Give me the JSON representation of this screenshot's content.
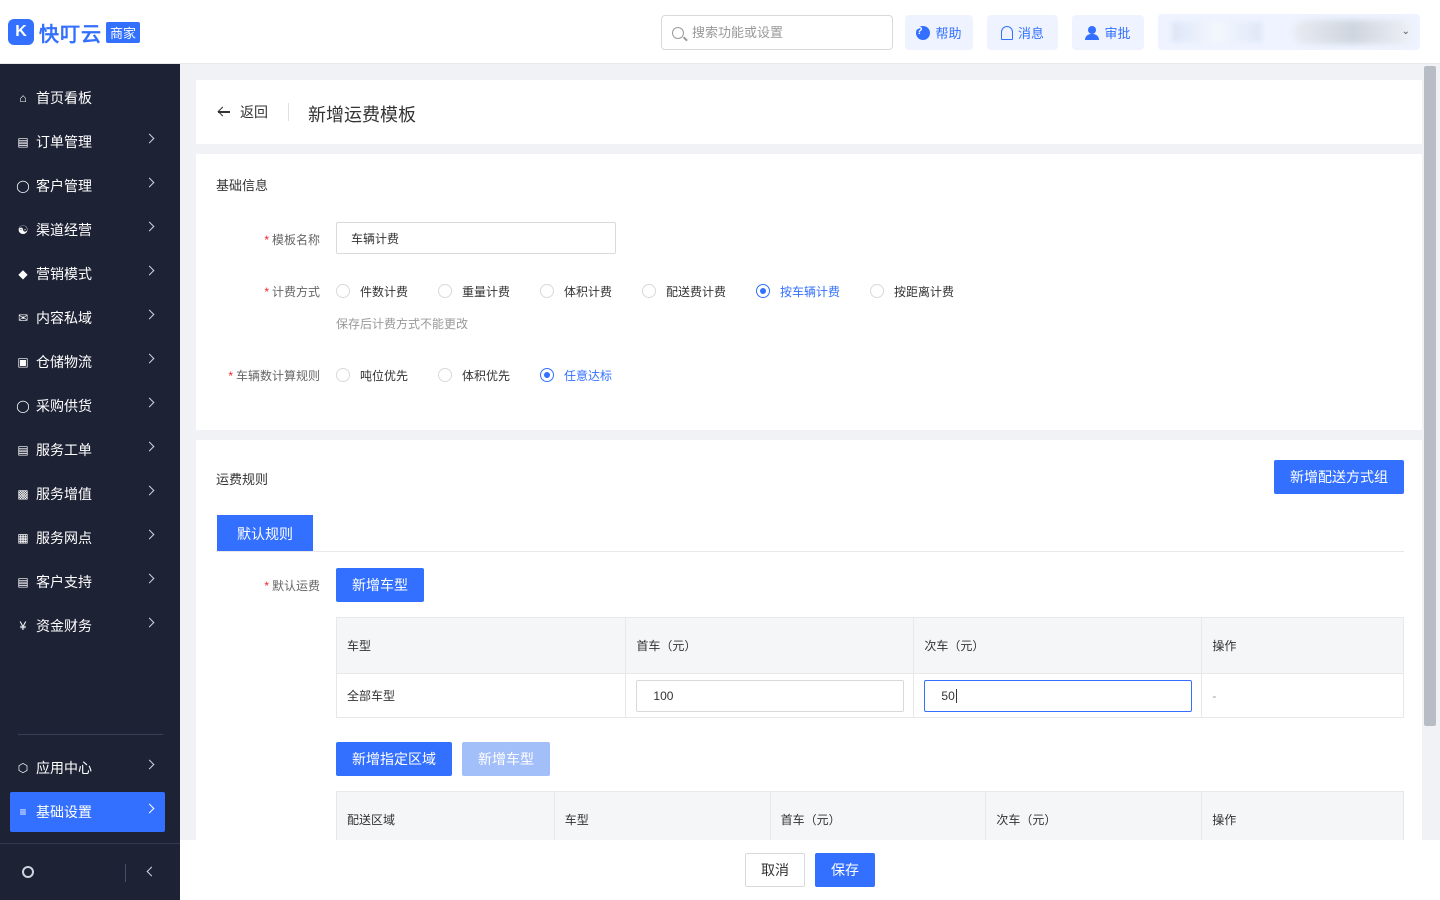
{
  "header": {
    "logo_text": "快叮云",
    "logo_badge": "商家",
    "search_placeholder": "搜索功能或设置",
    "help_label": "帮助",
    "messages_label": "消息",
    "approval_label": "审批"
  },
  "sidebar": {
    "items": [
      {
        "label": "首页看板",
        "icon": "home-icon"
      },
      {
        "label": "订单管理",
        "icon": "order-icon"
      },
      {
        "label": "客户管理",
        "icon": "user-icon"
      },
      {
        "label": "渠道经营",
        "icon": "channel-icon"
      },
      {
        "label": "营销模式",
        "icon": "tag-icon"
      },
      {
        "label": "内容私域",
        "icon": "mail-icon"
      },
      {
        "label": "仓储物流",
        "icon": "warehouse-icon"
      },
      {
        "label": "采购供货",
        "icon": "purchase-icon"
      },
      {
        "label": "服务工单",
        "icon": "ticket-icon"
      },
      {
        "label": "服务增值",
        "icon": "gift-icon"
      },
      {
        "label": "服务网点",
        "icon": "store-icon"
      },
      {
        "label": "客户支持",
        "icon": "support-icon"
      },
      {
        "label": "资金财务",
        "icon": "yen-icon"
      }
    ],
    "bottom_items": [
      {
        "label": "应用中心",
        "icon": "cube-icon"
      },
      {
        "label": "基础设置",
        "icon": "settings-list-icon",
        "active": true
      }
    ]
  },
  "page": {
    "back_label": "返回",
    "title": "新增运费模板"
  },
  "basic_info": {
    "section_title": "基础信息",
    "template_name_label": "模板名称",
    "template_name_value": "车辆计费",
    "billing_method_label": "计费方式",
    "billing_options": [
      "件数计费",
      "重量计费",
      "体积计费",
      "配送费计费",
      "按车辆计费",
      "按距离计费"
    ],
    "billing_selected": "按车辆计费",
    "billing_hint": "保存后计费方式不能更改",
    "vehicle_rule_label": "车辆数计算规则",
    "vehicle_rule_options": [
      "吨位优先",
      "体积优先",
      "任意达标"
    ],
    "vehicle_rule_selected": "任意达标"
  },
  "freight_rules": {
    "section_title": "运费规则",
    "add_group_button": "新增配送方式组",
    "tab_default": "默认规则",
    "default_fee_label": "默认运费",
    "add_vehicle_button": "新增车型",
    "default_table": {
      "headers": [
        "车型",
        "首车（元）",
        "次车（元）",
        "操作"
      ],
      "rows": [
        {
          "vehicle": "全部车型",
          "first": "100",
          "next": "50",
          "action": "-"
        }
      ]
    },
    "add_region_button": "新增指定区域",
    "add_vehicle_button_disabled": "新增车型",
    "region_table": {
      "headers": [
        "配送区域",
        "车型",
        "首车（元）",
        "次车（元）",
        "操作"
      ]
    }
  },
  "footer": {
    "cancel_label": "取消",
    "save_label": "保存"
  },
  "colors": {
    "primary": "#3370ff",
    "sidebar_bg": "#1e2235",
    "required": "#f5222d"
  }
}
